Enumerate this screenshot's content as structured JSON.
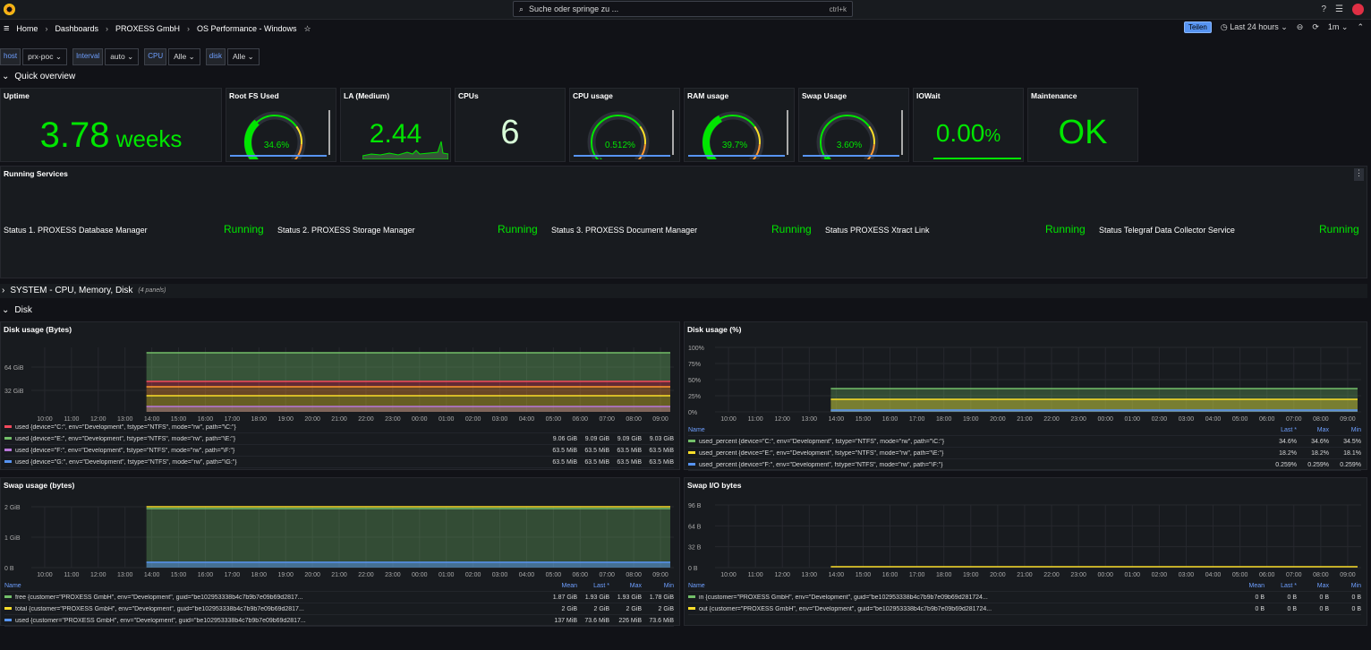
{
  "topbar": {
    "search_placeholder": "Suche oder springe zu ...",
    "shortcut": "ctrl+k"
  },
  "breadcrumb": [
    "Home",
    "Dashboards",
    "PROXESS GmbH",
    "OS Performance - Windows"
  ],
  "nav": {
    "share_label": "Teilen",
    "time_range": "Last 24 hours",
    "refresh": "1m"
  },
  "variables": [
    {
      "label": "host",
      "value": "prx-poc"
    },
    {
      "label": "Interval",
      "value": "auto"
    },
    {
      "label": "CPU",
      "value": "Alle"
    },
    {
      "label": "disk",
      "value": "Alle"
    }
  ],
  "rows": {
    "quick": "Quick overview",
    "system": "SYSTEM - CPU, Memory, Disk",
    "system_count": "(4 panels)",
    "disk": "Disk"
  },
  "stats": {
    "uptime": {
      "title": "Uptime",
      "value": "3.78",
      "unit": " weeks"
    },
    "rootfs": {
      "title": "Root FS Used",
      "value": "34.6%",
      "fraction": 0.346
    },
    "la": {
      "title": "LA (Medium)",
      "value": "2.44"
    },
    "cpus": {
      "title": "CPUs",
      "value": "6"
    },
    "cpu": {
      "title": "CPU usage",
      "value": "0.512%",
      "fraction": 0.00512
    },
    "ram": {
      "title": "RAM usage",
      "value": "39.7%",
      "fraction": 0.397
    },
    "swap": {
      "title": "Swap Usage",
      "value": "3.60%",
      "fraction": 0.036
    },
    "iowait": {
      "title": "IOWait",
      "value": "0.00",
      "unit": "%"
    },
    "maint": {
      "title": "Maintenance",
      "value": "OK"
    }
  },
  "services": {
    "title": "Running Services",
    "items": [
      {
        "label": "Status 1. PROXESS Database Manager",
        "state": "Running"
      },
      {
        "label": "Status 2. PROXESS Storage Manager",
        "state": "Running"
      },
      {
        "label": "Status 3. PROXESS Document Manager",
        "state": "Running"
      },
      {
        "label": "Status PROXESS Xtract Link",
        "state": "Running"
      },
      {
        "label": "Status Telegraf Data Collector Service",
        "state": "Running"
      }
    ]
  },
  "time_ticks": [
    "10:00",
    "11:00",
    "12:00",
    "13:00",
    "14:00",
    "15:00",
    "16:00",
    "17:00",
    "18:00",
    "19:00",
    "20:00",
    "21:00",
    "22:00",
    "23:00",
    "00:00",
    "01:00",
    "02:00",
    "03:00",
    "04:00",
    "05:00",
    "06:00",
    "07:00",
    "08:00",
    "09:00"
  ],
  "legend_cols": {
    "name": "Name",
    "mean": "Mean",
    "last": "Last *",
    "max": "Max",
    "min": "Min"
  },
  "colors": {
    "green": "#73bf69",
    "yellow": "#fade2a",
    "red": "#f2495c",
    "blue": "#5794f2",
    "orange": "#ff9830",
    "purple": "#b877d9"
  },
  "chart_data": [
    {
      "type": "area",
      "title": "Disk usage (Bytes)",
      "y_ticks": [
        "64 GiB",
        "32 GiB"
      ],
      "legend": [
        {
          "name": "used {device=\"C:\", env=\"Development\", fstype=\"NTFS\", mode=\"rw\", path=\"\\C:\"}",
          "mean": "",
          "last": "",
          "max": "",
          "min": "",
          "color": "#f2495c"
        },
        {
          "name": "used {device=\"E:\", env=\"Development\", fstype=\"NTFS\", mode=\"rw\", path=\"\\E:\"}",
          "mean": "9.06 GiB",
          "last": "9.09 GiB",
          "max": "9.09 GiB",
          "min": "9.03 GiB",
          "color": "#73bf69"
        },
        {
          "name": "used {device=\"F:\", env=\"Development\", fstype=\"NTFS\", mode=\"rw\", path=\"\\F:\"}",
          "mean": "63.5 MiB",
          "last": "63.5 MiB",
          "max": "63.5 MiB",
          "min": "63.5 MiB",
          "color": "#b877d9"
        },
        {
          "name": "used {device=\"G:\", env=\"Development\", fstype=\"NTFS\", mode=\"rw\", path=\"\\G:\"}",
          "mean": "63.5 MiB",
          "last": "63.5 MiB",
          "max": "63.5 MiB",
          "min": "63.5 MiB",
          "color": "#5794f2"
        }
      ]
    },
    {
      "type": "area",
      "title": "Disk usage (%)",
      "y_ticks": [
        "100%",
        "75%",
        "50%",
        "25%",
        "0%"
      ],
      "legend": [
        {
          "name": "used_percent {device=\"C:\", env=\"Development\", fstype=\"NTFS\", mode=\"rw\", path=\"\\C:\"}",
          "last": "34.6%",
          "max": "34.6%",
          "min": "34.5%",
          "color": "#73bf69"
        },
        {
          "name": "used_percent {device=\"E:\", env=\"Development\", fstype=\"NTFS\", mode=\"rw\", path=\"\\E:\"}",
          "last": "18.2%",
          "max": "18.2%",
          "min": "18.1%",
          "color": "#fade2a"
        },
        {
          "name": "used_percent {device=\"F:\", env=\"Development\", fstype=\"NTFS\", mode=\"rw\", path=\"\\F:\"}",
          "last": "0.259%",
          "max": "0.259%",
          "min": "0.259%",
          "color": "#5794f2"
        }
      ]
    },
    {
      "type": "area",
      "title": "Swap usage (bytes)",
      "y_ticks": [
        "2 GiB",
        "1 GiB",
        "0 B"
      ],
      "legend": [
        {
          "name": "free {customer=\"PROXESS GmbH\", env=\"Development\", guid=\"be102953338b4c7b9b7e09b69d2817...",
          "mean": "1.87 GiB",
          "last": "1.93 GiB",
          "max": "1.93 GiB",
          "min": "1.78 GiB",
          "color": "#73bf69"
        },
        {
          "name": "total {customer=\"PROXESS GmbH\", env=\"Development\", guid=\"be102953338b4c7b9b7e09b69d2817...",
          "mean": "2 GiB",
          "last": "2 GiB",
          "max": "2 GiB",
          "min": "2 GiB",
          "color": "#fade2a"
        },
        {
          "name": "used {customer=\"PROXESS GmbH\", env=\"Development\", guid=\"be102953338b4c7b9b7e09b69d2817...",
          "mean": "137 MiB",
          "last": "73.6 MiB",
          "max": "226 MiB",
          "min": "73.6 MiB",
          "color": "#5794f2"
        }
      ]
    },
    {
      "type": "line",
      "title": "Swap I/O bytes",
      "y_ticks": [
        "96 B",
        "64 B",
        "32 B",
        "0 B"
      ],
      "legend": [
        {
          "name": "in {customer=\"PROXESS GmbH\", env=\"Development\", guid=\"be102953338b4c7b9b7e09b69d281724...",
          "mean": "0 B",
          "last": "0 B",
          "max": "0 B",
          "min": "0 B",
          "color": "#73bf69"
        },
        {
          "name": "out {customer=\"PROXESS GmbH\", env=\"Development\", guid=\"be102953338b4c7b9b7e09b69d281724...",
          "mean": "0 B",
          "last": "0 B",
          "max": "0 B",
          "min": "0 B",
          "color": "#fade2a"
        }
      ]
    }
  ]
}
